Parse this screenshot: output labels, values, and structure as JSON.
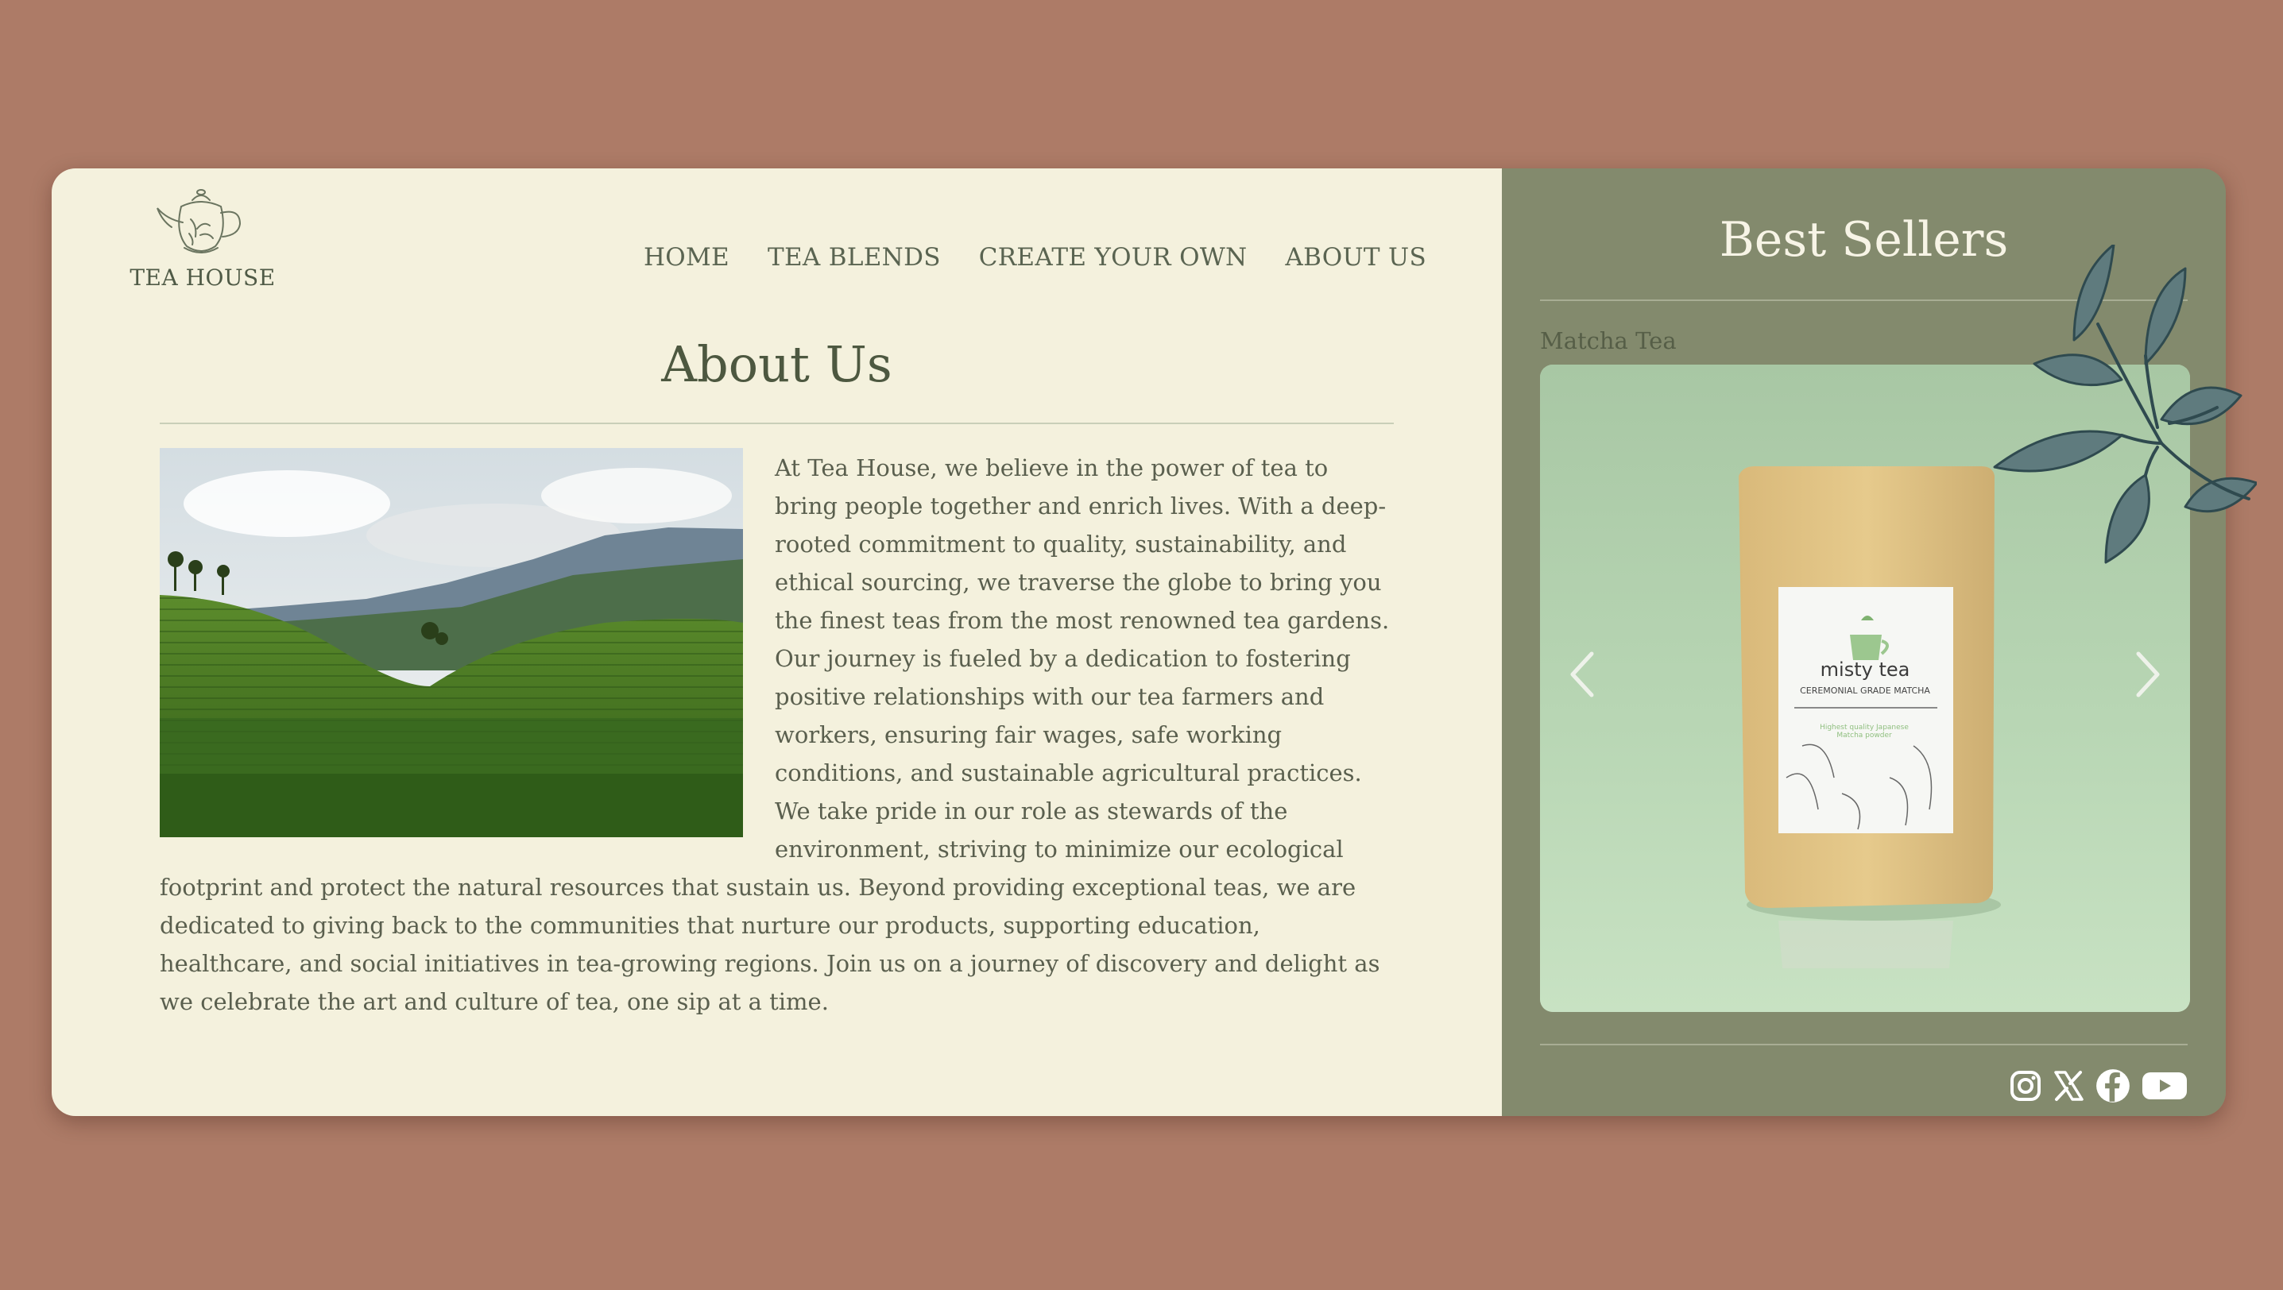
{
  "brand": {
    "name": "TEA HOUSE"
  },
  "nav": {
    "items": [
      "HOME",
      "TEA BLENDS",
      "CREATE YOUR OWN",
      "ABOUT US"
    ]
  },
  "about": {
    "title": "About Us",
    "body": "At Tea House, we believe in the power of tea to bring people together and enrich lives. With a deep-rooted commitment to quality, sustainability, and ethical sourcing, we traverse the globe to bring you the finest teas from the most renowned tea gardens. Our journey is fueled by a dedication to fostering positive relationships with our tea farmers and workers, ensuring fair wages, safe working conditions, and sustainable agricultural practices. We take pride in our role as stewards of the environment, striving to minimize our ecological footprint and protect the natural resources that sustain us. Beyond providing exceptional teas, we are dedicated to giving back to the communities that nurture our products, supporting education, healthcare, and social initiatives in tea-growing regions. Join us on a journey of discovery and delight as we celebrate the art and culture of tea, one sip at a time."
  },
  "best_sellers": {
    "title": "Best Sellers",
    "product_name": "Matcha Tea",
    "package": {
      "brand": "misty tea",
      "subtitle": "CEREMONIAL GRADE MATCHA",
      "tagline": "Highest quality Japanese Matcha powder"
    }
  },
  "socials": [
    "instagram-icon",
    "x-icon",
    "facebook-icon",
    "youtube-icon"
  ],
  "colors": {
    "background": "#ad7b67",
    "panel_left": "#f4f1dd",
    "panel_right": "#838a6d",
    "carousel_bg": "#b3d3b0"
  }
}
